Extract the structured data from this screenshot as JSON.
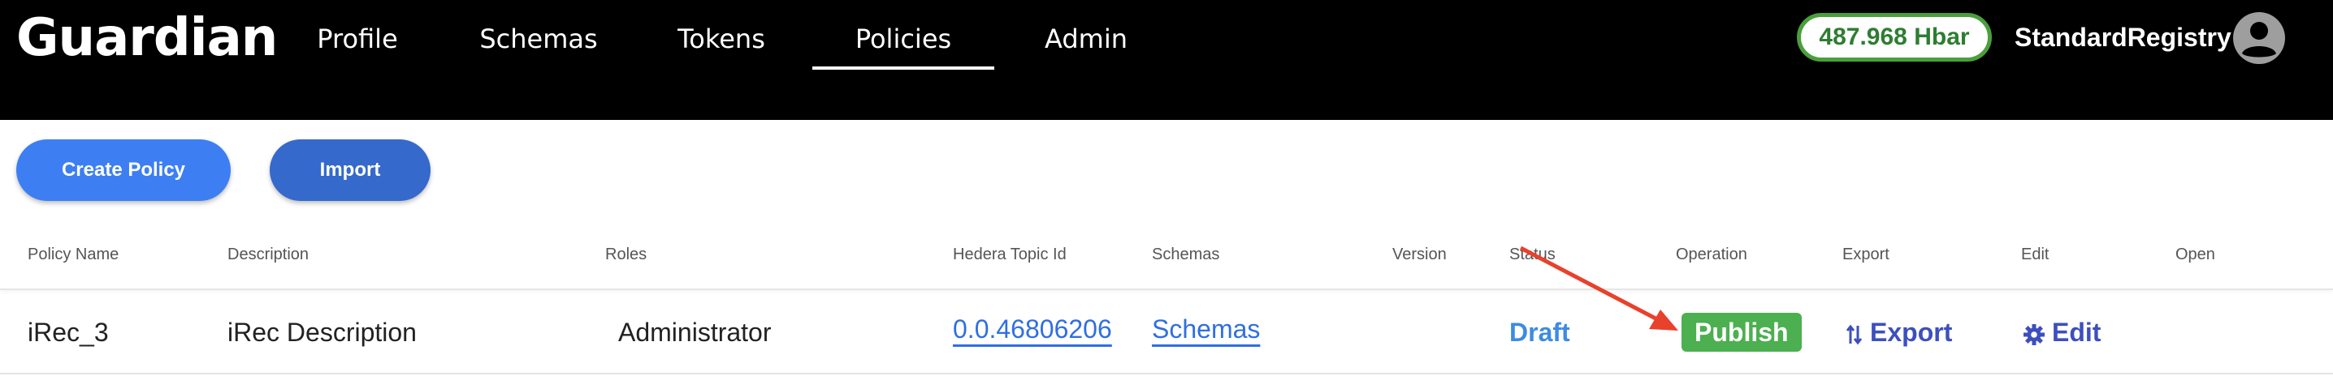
{
  "app": {
    "title": "Guardian"
  },
  "nav": {
    "items": [
      {
        "label": "Profile",
        "active": false
      },
      {
        "label": "Schemas",
        "active": false
      },
      {
        "label": "Tokens",
        "active": false
      },
      {
        "label": "Policies",
        "active": true
      },
      {
        "label": "Admin",
        "active": false
      }
    ]
  },
  "account": {
    "balance": "487.968 Hbar",
    "username": "StandardRegistry",
    "avatar_icon": "user-circle-icon"
  },
  "toolbar": {
    "create_label": "Create Policy",
    "import_label": "Import"
  },
  "table": {
    "columns": [
      "Policy Name",
      "Description",
      "Roles",
      "Hedera Topic Id",
      "Schemas",
      "Version",
      "Status",
      "Operation",
      "Export",
      "Edit",
      "Open"
    ],
    "rows": [
      {
        "policy_name": "iRec_3",
        "description": "iRec Description",
        "roles": "Administrator",
        "topic_id": "0.0.46806206",
        "schemas": "Schemas",
        "version": "",
        "status": "Draft",
        "operation": "Publish",
        "export": "Export",
        "edit": "Edit",
        "open": ""
      }
    ]
  },
  "colors": {
    "header_bg": "#000000",
    "primary_button": "#3d7ff2",
    "import_button": "#3569cc",
    "publish_bg": "#4caf50",
    "balance_border": "#4a9f3c",
    "link": "#2f6fe0",
    "annotation_arrow": "#e8412c"
  }
}
